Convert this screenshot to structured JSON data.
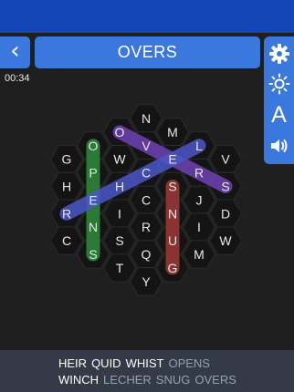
{
  "header": {
    "back_glyph": "‹",
    "title": "OVERS"
  },
  "timer": "00:34",
  "toolbar": {
    "settings": "gear-icon",
    "brightness": "sun-icon",
    "font": "A",
    "sound": "speaker-icon"
  },
  "board": {
    "rows": [
      [
        {
          "r": 0,
          "c": 0,
          "t": "N"
        }
      ],
      [
        {
          "r": 1,
          "c": -1,
          "t": "O"
        },
        {
          "r": 1,
          "c": 1,
          "t": "M"
        }
      ],
      [
        {
          "r": 2,
          "c": -2,
          "t": "O"
        },
        {
          "r": 2,
          "c": 0,
          "t": "V"
        },
        {
          "r": 2,
          "c": 2,
          "t": "L"
        }
      ],
      [
        {
          "r": 3,
          "c": -3,
          "t": "G"
        },
        {
          "r": 3,
          "c": -1,
          "t": "W"
        },
        {
          "r": 3,
          "c": 1,
          "t": "E"
        },
        {
          "r": 3,
          "c": 3,
          "t": "V"
        }
      ],
      [
        {
          "r": 4,
          "c": -2,
          "t": "P"
        },
        {
          "r": 4,
          "c": 0,
          "t": "C"
        },
        {
          "r": 4,
          "c": 2,
          "t": "R"
        }
      ],
      [
        {
          "r": 5,
          "c": -3,
          "t": "H"
        },
        {
          "r": 5,
          "c": -1,
          "t": "H"
        },
        {
          "r": 5,
          "c": 1,
          "t": "S"
        },
        {
          "r": 5,
          "c": 3,
          "t": "S"
        }
      ],
      [
        {
          "r": 6,
          "c": -2,
          "t": "E"
        },
        {
          "r": 6,
          "c": 0,
          "t": "C"
        },
        {
          "r": 6,
          "c": 2,
          "t": "J"
        }
      ],
      [
        {
          "r": 7,
          "c": -3,
          "t": "R"
        },
        {
          "r": 7,
          "c": -1,
          "t": "I"
        },
        {
          "r": 7,
          "c": 1,
          "t": "N"
        },
        {
          "r": 7,
          "c": 3,
          "t": "D"
        }
      ],
      [
        {
          "r": 8,
          "c": -2,
          "t": "N"
        },
        {
          "r": 8,
          "c": 0,
          "t": "R"
        },
        {
          "r": 8,
          "c": 2,
          "t": "I"
        }
      ],
      [
        {
          "r": 9,
          "c": -3,
          "t": "C"
        },
        {
          "r": 9,
          "c": -1,
          "t": "S"
        },
        {
          "r": 9,
          "c": 1,
          "t": "U"
        },
        {
          "r": 9,
          "c": 3,
          "t": "W"
        }
      ],
      [
        {
          "r": 10,
          "c": -2,
          "t": "S"
        },
        {
          "r": 10,
          "c": 0,
          "t": "Q"
        },
        {
          "r": 10,
          "c": 2,
          "t": "M"
        }
      ],
      [
        {
          "r": 11,
          "c": -1,
          "t": "T"
        },
        {
          "r": 11,
          "c": 1,
          "t": "G"
        }
      ],
      [
        {
          "r": 12,
          "c": 0,
          "t": "Y"
        }
      ]
    ],
    "found_paths": [
      {
        "word": "OPENS",
        "color": "#2e8b3a",
        "cells": [
          [
            2,
            -2
          ],
          [
            10,
            -2
          ]
        ]
      },
      {
        "word": "OVERS",
        "color": "#6e42b4",
        "cells": [
          [
            1,
            -1
          ],
          [
            5,
            3
          ]
        ]
      },
      {
        "word": "LECHER",
        "color": "#4a56c8",
        "cells": [
          [
            2,
            2
          ],
          [
            7,
            -3
          ]
        ]
      },
      {
        "word": "SNUG",
        "color": "#a03838",
        "cells": [
          [
            5,
            1
          ],
          [
            11,
            1
          ]
        ]
      }
    ]
  },
  "words": {
    "row1": [
      {
        "text": "HEIR",
        "found": false
      },
      {
        "text": "QUID",
        "found": false
      },
      {
        "text": "WHIST",
        "found": false
      },
      {
        "text": "OPENS",
        "found": true
      }
    ],
    "row2": [
      {
        "text": "WINCH",
        "found": false
      },
      {
        "text": "LECHER",
        "found": true
      },
      {
        "text": "SNUG",
        "found": true
      },
      {
        "text": "OVERS",
        "found": true
      }
    ]
  }
}
